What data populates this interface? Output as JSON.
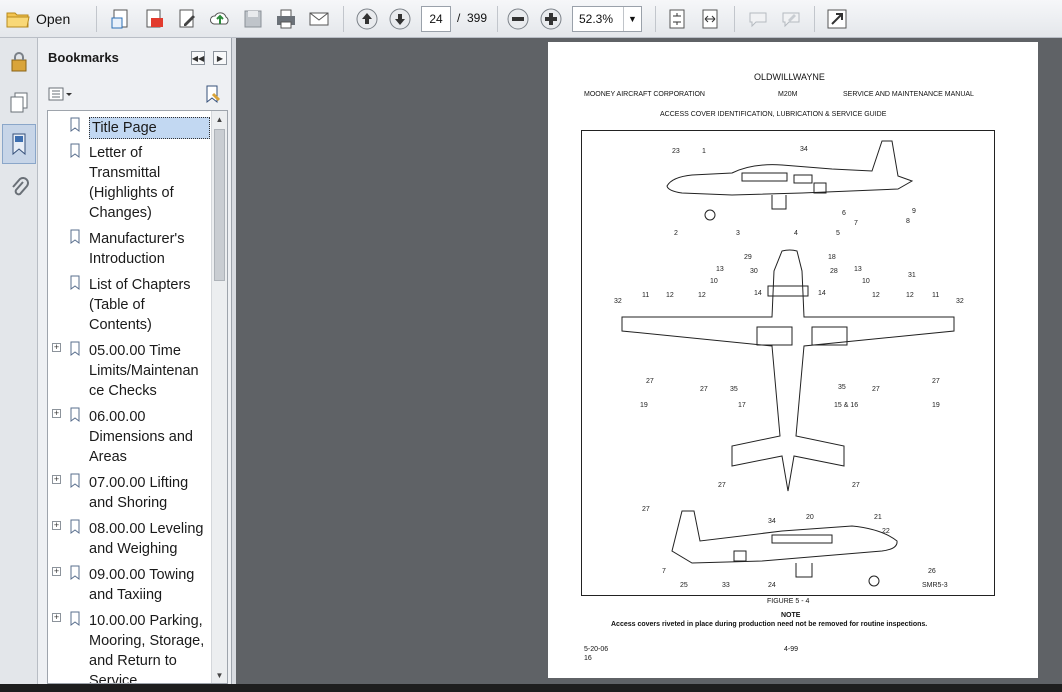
{
  "toolbar": {
    "open_label": "Open",
    "page_current": "24",
    "page_separator": "/",
    "page_total": "399",
    "zoom_value": "52.3%",
    "icons": [
      "create-pdf-icon",
      "export-icon",
      "edit-icon",
      "upload-cloud-icon",
      "save-icon",
      "print-icon",
      "email-icon",
      "previous-page-icon",
      "next-page-icon",
      "zoom-out-icon",
      "zoom-in-icon",
      "fit-page-icon",
      "fit-width-icon",
      "comment-icon",
      "highlight-icon",
      "fullscreen-icon"
    ]
  },
  "sidebar": {
    "rail_icons": [
      "lock-icon",
      "pages-icon",
      "bookmark-icon",
      "attachment-icon"
    ],
    "title": "Bookmarks",
    "bookmarks": [
      {
        "label": "Title Page",
        "selected": true,
        "expandable": false
      },
      {
        "label": "Letter of Transmittal (Highlights of Changes)",
        "selected": false,
        "expandable": false
      },
      {
        "label": "Manufacturer's Introduction",
        "selected": false,
        "expandable": false
      },
      {
        "label": "List of Chapters (Table of Contents)",
        "selected": false,
        "expandable": false
      },
      {
        "label": "05.00.00 Time Limits/Maintenance Checks",
        "selected": false,
        "expandable": true
      },
      {
        "label": "06.00.00 Dimensions and Areas",
        "selected": false,
        "expandable": true
      },
      {
        "label": "07.00.00 Lifting and Shoring",
        "selected": false,
        "expandable": true
      },
      {
        "label": "08.00.00 Leveling and Weighing",
        "selected": false,
        "expandable": true
      },
      {
        "label": "09.00.00 Towing and Taxiing",
        "selected": false,
        "expandable": true
      },
      {
        "label": "10.00.00 Parking, Mooring, Storage, and Return to Service",
        "selected": false,
        "expandable": true
      }
    ]
  },
  "document": {
    "watermark": "OLDWILLWAYNE",
    "header_left": "MOONEY AIRCRAFT CORPORATION",
    "header_center": "M20M",
    "header_right": "SERVICE AND MAINTENANCE MANUAL",
    "subtitle": "ACCESS COVER IDENTIFICATION, LUBRICATION & SERVICE GUIDE",
    "figure_label": "FIGURE 5 - 4",
    "figure_code": "SMR5-3",
    "note_title": "NOTE",
    "note_text": "Access covers riveted in place during production need not be removed for routine inspections.",
    "footer_date": "5-20-06",
    "footer_num": "16",
    "footer_page": "4-99",
    "callouts": {
      "side_top": [
        "23",
        "1",
        "34",
        "6",
        "7",
        "8",
        "9",
        "5",
        "4",
        "3",
        "2"
      ],
      "plan": [
        "29",
        "18",
        "30",
        "28",
        "13",
        "13",
        "10",
        "10",
        "14",
        "14",
        "31",
        "11",
        "12",
        "12",
        "12",
        "12",
        "11",
        "32",
        "32",
        "27",
        "27",
        "35",
        "35",
        "27",
        "27",
        "19",
        "17",
        "15 & 16",
        "19",
        "27",
        "27"
      ],
      "side_bottom": [
        "27",
        "34",
        "20",
        "21",
        "22",
        "7",
        "25",
        "33",
        "24",
        "26"
      ]
    }
  }
}
